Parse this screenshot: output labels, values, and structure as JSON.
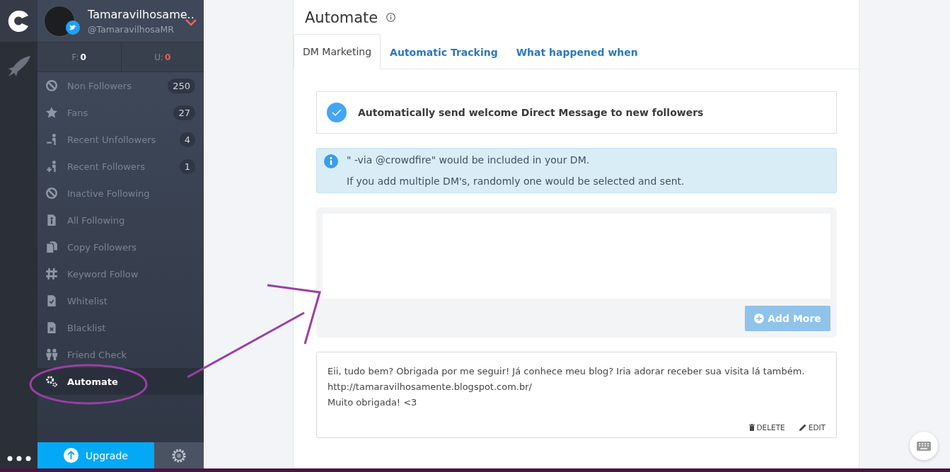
{
  "profile": {
    "name": "Tamaravilhosame..",
    "handle": "@TamaravilhosaMR"
  },
  "stats": [
    {
      "label": "F:",
      "value": "0",
      "color": "#ffffff"
    },
    {
      "label": "U:",
      "value": "0",
      "color": "#e8615a"
    }
  ],
  "sidebar": {
    "items": [
      {
        "label": "Non Followers",
        "count": "250",
        "selected": false
      },
      {
        "label": "Fans",
        "count": "27",
        "selected": false
      },
      {
        "label": "Recent Unfollowers",
        "count": "4",
        "selected": false
      },
      {
        "label": "Recent Followers",
        "count": "1",
        "selected": false
      },
      {
        "label": "Inactive Following",
        "selected": false
      },
      {
        "label": "All Following",
        "selected": false
      },
      {
        "label": "Copy Followers",
        "selected": false
      },
      {
        "label": "Keyword Follow",
        "selected": false
      },
      {
        "label": "Whitelist",
        "selected": false
      },
      {
        "label": "Blacklist",
        "selected": false
      },
      {
        "label": "Friend Check",
        "selected": false
      },
      {
        "label": "Automate",
        "selected": true
      }
    ]
  },
  "upgrade": "Upgrade",
  "page": {
    "title": "Automate",
    "tabs": [
      {
        "label": "DM Marketing",
        "selected": true
      },
      {
        "label": "Automatic Tracking",
        "selected": false
      },
      {
        "label": "What happened when",
        "selected": false
      }
    ],
    "toggle": {
      "label": "Automatically send welcome Direct Message to new followers",
      "checked": true
    },
    "info": [
      "\" -via @crowdfire\" would be included in your DM.",
      "If you add multiple DM's, randomly one would be selected and sent."
    ],
    "composer": {
      "button": "Add More",
      "disabled": true
    },
    "messages": [
      {
        "text": "Eii, tudo bem? Obrigada por me seguir! Já conhece meu blog? Iria adorar receber sua visita lá também.\nhttp://tamaravilhosamente.blogspot.com.br/\nMuito obrigada! <3",
        "delete": "DELETE",
        "edit": "EDIT"
      }
    ]
  }
}
